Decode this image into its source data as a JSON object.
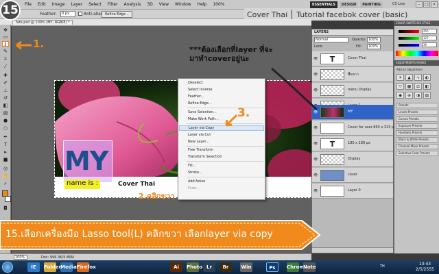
{
  "step_number": "15",
  "titlebar": {
    "menu": [
      "File",
      "Edit",
      "Image",
      "Layer",
      "Select",
      "Filter",
      "Analysis",
      "3D",
      "View",
      "Window",
      "Help"
    ],
    "zoom_readout": "100%",
    "workspaces": [
      "ESSENTIALS",
      "DESIGN",
      "PAINTING"
    ],
    "cs_live": "CS Live",
    "window_buttons": [
      "–",
      "□",
      "×"
    ]
  },
  "tutorial_title": {
    "left": "Cover Thai",
    "right": "Tutorial facebok cover (basic)"
  },
  "options_bar": {
    "feather_label": "Feather:",
    "feather_value": "0 px",
    "antialias_label": "Anti-alias",
    "refine_edge_label": "Refine Edge..."
  },
  "document": {
    "tab_name": "fafe.psd @ 100% (MY, RGB/8) *",
    "zoom": "100%",
    "doc_size": "Doc: 996.3K/5.86M"
  },
  "cover": {
    "big_text": "MY",
    "name_text": "name is :",
    "label": "Cover Thai"
  },
  "context_menu": {
    "items": [
      {
        "label": "Deselect",
        "state": "normal"
      },
      {
        "label": "Select Inverse",
        "state": "normal"
      },
      {
        "label": "Feather...",
        "state": "normal"
      },
      {
        "label": "Refine Edge...",
        "state": "normal"
      },
      {
        "label": "Save Selection...",
        "state": "normal"
      },
      {
        "label": "Make Work Path...",
        "state": "normal"
      },
      {
        "label": "Layer via Copy",
        "state": "highlighted"
      },
      {
        "label": "Layer via Cut",
        "state": "normal"
      },
      {
        "label": "New Layer...",
        "state": "normal"
      },
      {
        "label": "Free Transform",
        "state": "normal"
      },
      {
        "label": "Transform Selection",
        "state": "normal"
      },
      {
        "label": "Fill...",
        "state": "normal"
      },
      {
        "label": "Stroke...",
        "state": "normal"
      },
      {
        "label": "Add Noise",
        "state": "normal"
      },
      {
        "label": "Fade...",
        "state": "disabled"
      }
    ]
  },
  "annotations": {
    "step1": "1.",
    "step2": "2.คลิกขวา",
    "step3": "3.",
    "note_line1": "***ต้องเลือกที่layer ที่จะ",
    "note_line2": "มาทำcoverอยู่นะ",
    "banner": "15.เลือกเครื่องมือ Lasso tool(L) คลิกขวา เลือกlayer via copy",
    "accent_color": "#f08a1c"
  },
  "layers_panel": {
    "title": "LAYERS",
    "blend_mode": "Normal",
    "opacity_label": "Opacity:",
    "opacity_value": "100%",
    "lock_label": "Lock:",
    "fill_label": "Fill:",
    "fill_value": "100%",
    "layers": [
      {
        "name": "Cover Thai",
        "thumb": "text",
        "selected": false
      },
      {
        "name": "พื้นขาว",
        "thumb": "checker",
        "selected": false
      },
      {
        "name": "menu Display",
        "thumb": "checker",
        "selected": false
      },
      {
        "name": "Layer 1",
        "thumb": "checker",
        "selected": false
      },
      {
        "name": "MY",
        "thumb": "photo",
        "selected": true
      },
      {
        "name": "Cover for user 850 x 315 px",
        "thumb": "white",
        "selected": false
      },
      {
        "name": "180 x 180 px",
        "thumb": "text",
        "selected": false
      },
      {
        "name": "Display",
        "thumb": "checker",
        "selected": false
      },
      {
        "name": "cover",
        "thumb": "blue",
        "selected": false
      },
      {
        "name": "Layer 0",
        "thumb": "white",
        "selected": false
      }
    ]
  },
  "right_panels": {
    "color_head": "COLOR   SWATCHES   STYLE",
    "rgb_values": [
      "255",
      "127",
      "39"
    ],
    "adjust_head": "ADJUSTMENTS  MASKS",
    "add_adjustment": "Add an adjustment",
    "presets": [
      "Presets",
      "Levels Presets",
      "Curves Presets",
      "Exposure Presets",
      "Hue/Satu Presets",
      "Black & White Presets",
      "Channel Mixer Presets",
      "Selective Color Presets"
    ]
  },
  "taskbar": {
    "apps": [
      "IE",
      "Folder",
      "Media",
      "Firefox",
      "Ai",
      "Photo",
      "Lr",
      "Br",
      "Win",
      "Ps",
      "Chrome",
      "Note"
    ],
    "language": "TH",
    "time": "13:43",
    "date": "2/5/2555"
  }
}
